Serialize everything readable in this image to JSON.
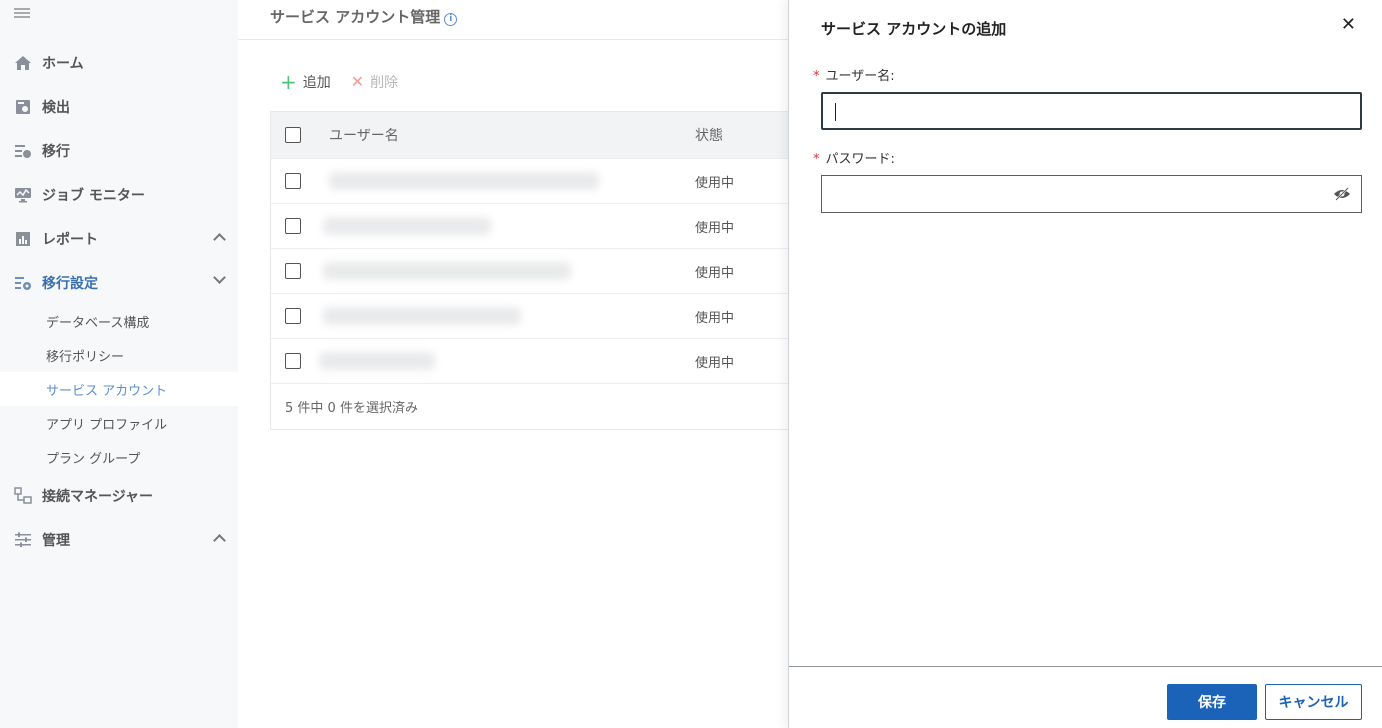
{
  "sidebar": {
    "items": [
      {
        "label": "ホーム",
        "icon": "home-icon"
      },
      {
        "label": "検出",
        "icon": "discovery-icon"
      },
      {
        "label": "移行",
        "icon": "migration-icon"
      },
      {
        "label": "ジョブ モニター",
        "icon": "monitor-icon"
      },
      {
        "label": "レポート",
        "icon": "report-icon"
      },
      {
        "label": "移行設定",
        "icon": "settings-icon"
      },
      {
        "label": "接続マネージャー",
        "icon": "connection-icon"
      },
      {
        "label": "管理",
        "icon": "admin-icon"
      }
    ],
    "sub_items": [
      {
        "label": "データベース構成"
      },
      {
        "label": "移行ポリシー"
      },
      {
        "label": "サービス アカウント"
      },
      {
        "label": "アプリ プロファイル"
      },
      {
        "label": "プラン グループ"
      }
    ]
  },
  "main": {
    "title": "サービス アカウント管理",
    "info_icon": "i",
    "toolbar": {
      "add_label": "追加",
      "delete_label": "削除"
    },
    "table": {
      "headers": {
        "username": "ユーザー名",
        "status": "状態"
      },
      "rows": [
        {
          "status": "使用中"
        },
        {
          "status": "使用中"
        },
        {
          "status": "使用中"
        },
        {
          "status": "使用中"
        },
        {
          "status": "使用中"
        }
      ],
      "footer": "5 件中 0 件を選択済み"
    }
  },
  "drawer": {
    "title": "サービス アカウントの追加",
    "close_symbol": "✕",
    "username_label": "ユーザー名:",
    "username_value": "",
    "password_label": "パスワード:",
    "password_value": "",
    "required_mark": "*",
    "save_label": "保存",
    "cancel_label": "キャンセル"
  },
  "colors": {
    "accent": "#1b63b8",
    "active_nav": "#3a6fb0",
    "required": "#e03131",
    "add_icon": "#52c27a"
  }
}
